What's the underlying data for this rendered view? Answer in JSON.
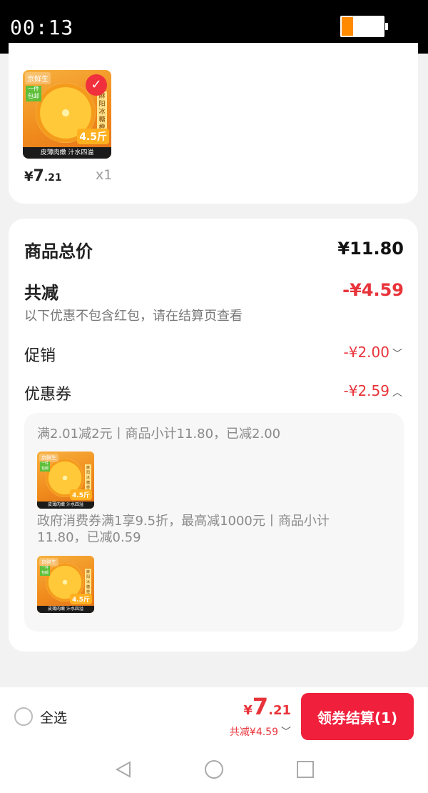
{
  "status_bar": {
    "time": "00:13",
    "battery_level_fraction": 0.28
  },
  "cart_item": {
    "thumb": {
      "brand": "京鲜生",
      "tag": "一件包邮",
      "side_tag": "麻阳冰糖橙",
      "weight": "4.5斤",
      "caption": "皮薄肉嫩 汁水四溢"
    },
    "price_yen": "¥",
    "price_int": "7",
    "price_dec": ".21",
    "quantity": "x1",
    "selected": true
  },
  "summary": {
    "total_label": "商品总价",
    "total_value": "¥11.80",
    "discount_label": "共减",
    "discount_value": "-¥4.59",
    "discount_note": "以下优惠不包含红包，请在结算页查看",
    "promo_label": "促销",
    "promo_value": "-¥2.00",
    "coupon_label": "优惠券",
    "coupon_value": "-¥2.59",
    "coupons": [
      {
        "text": "满2.01减2元丨商品小计11.80，已减2.00"
      },
      {
        "text": "政府消费券满1享9.5折，最高减1000元丨商品小计11.80，已减0.59"
      }
    ]
  },
  "bottom_bar": {
    "select_all_label": "全选",
    "total_yen": "¥",
    "total_int": "7",
    "total_dec": ".21",
    "discount_text": "共减¥4.59",
    "checkout_label": "领券结算(1)"
  },
  "icons": {
    "check": "check-icon",
    "chevron_down": "chevron-down-icon",
    "chevron_up": "chevron-up-icon",
    "nav_back": "back-icon",
    "nav_home": "home-icon",
    "nav_recent": "recent-apps-icon"
  },
  "colors": {
    "accent": "#e8333a",
    "checkout": "#f01f3c",
    "battery": "#ff8a00"
  }
}
